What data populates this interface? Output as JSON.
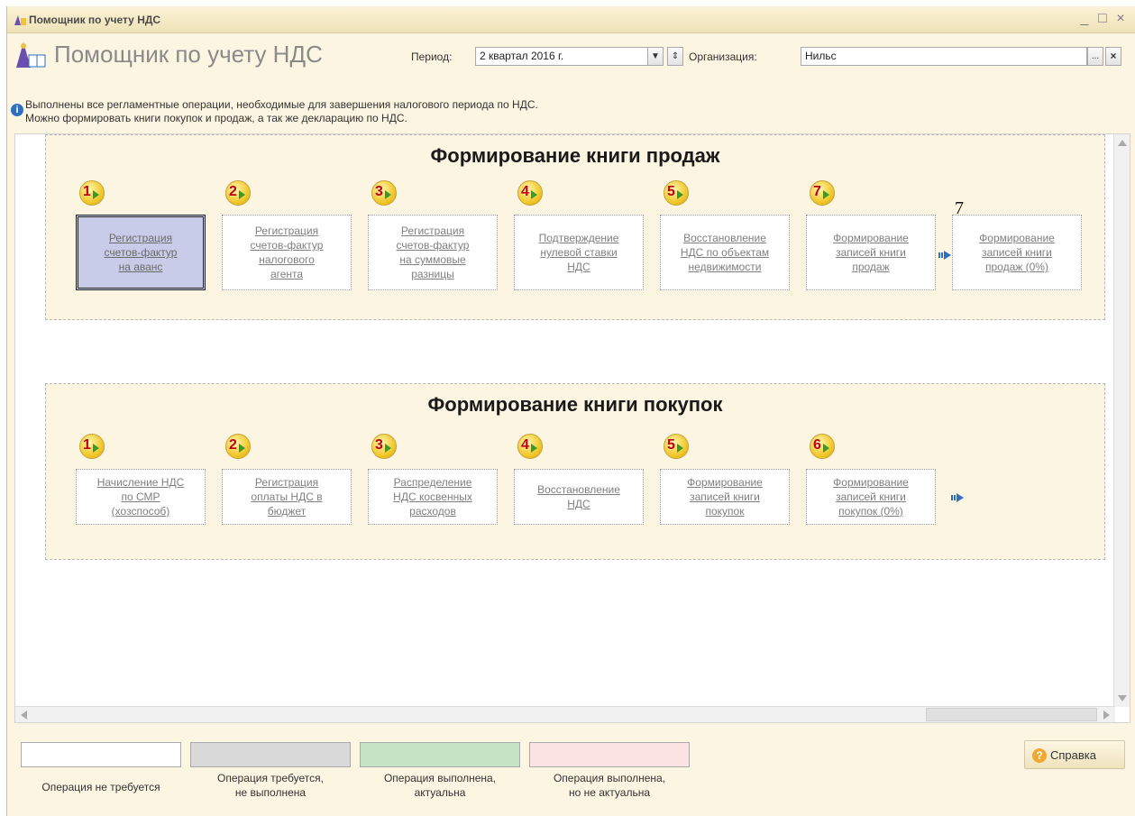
{
  "window": {
    "title": "Помощник по учету НДС",
    "min": "_",
    "max": "□",
    "close": "×"
  },
  "header": {
    "app_title": "Помощник по учету НДС",
    "period_label": "Период:",
    "period_value": "2 квартал 2016 г.",
    "org_label": "Организация:",
    "org_value": "Нильс",
    "ellipsis": "...",
    "clear": "×"
  },
  "info": {
    "line1": "Выполнены все регламентные операции, необходимые для завершения налогового периода по НДС.",
    "line2": "Можно формировать книги покупок и продаж, а так же декларацию по НДС."
  },
  "sales": {
    "title": "Формирование книги продаж",
    "extra_label": "7",
    "steps": [
      {
        "num": "1",
        "label": "Регистрация\nсчетов-фактур\nна аванс"
      },
      {
        "num": "2",
        "label": "Регистрация\nсчетов-фактур\nналогового\nагента"
      },
      {
        "num": "3",
        "label": "Регистрация\nсчетов-фактур\nна суммовые\nразницы"
      },
      {
        "num": "4",
        "label": "Подтверждение\nнулевой ставки\nНДС"
      },
      {
        "num": "5",
        "label": "Восстановление\nНДС по объектам\nнедвижимости"
      },
      {
        "num": "7",
        "label": "Формирование\nзаписей книги\nпродаж"
      },
      {
        "num": "",
        "label": "Формирование\nзаписей книги\nпродаж (0%)"
      }
    ]
  },
  "purchases": {
    "title": "Формирование книги покупок",
    "steps": [
      {
        "num": "1",
        "label": "Начисление НДС\nпо СМР\n(хозспособ)"
      },
      {
        "num": "2",
        "label": "Регистрация\nоплаты НДС в\nбюджет"
      },
      {
        "num": "3",
        "label": "Распределение\nНДС косвенных\nрасходов"
      },
      {
        "num": "4",
        "label": "Восстановление\nНДС"
      },
      {
        "num": "5",
        "label": "Формирование\nзаписей книги\nпокупок"
      },
      {
        "num": "6",
        "label": "Формирование\nзаписей книги\nпокупок (0%)"
      }
    ]
  },
  "legend": [
    {
      "label": "Операция не требуется",
      "color": "#ffffff"
    },
    {
      "label": "Операция требуется,\nне выполнена",
      "color": "#d9d9d9"
    },
    {
      "label": "Операция выполнена,\nактуальна",
      "color": "#c6e3c6"
    },
    {
      "label": "Операция выполнена,\nно не актуальна",
      "color": "#fbe3e3"
    }
  ],
  "help_label": "Справка",
  "colors": {
    "accent_selected": "#c9cce8",
    "step_number": "#c0001a",
    "panel_bg": "#fbf5e1"
  }
}
